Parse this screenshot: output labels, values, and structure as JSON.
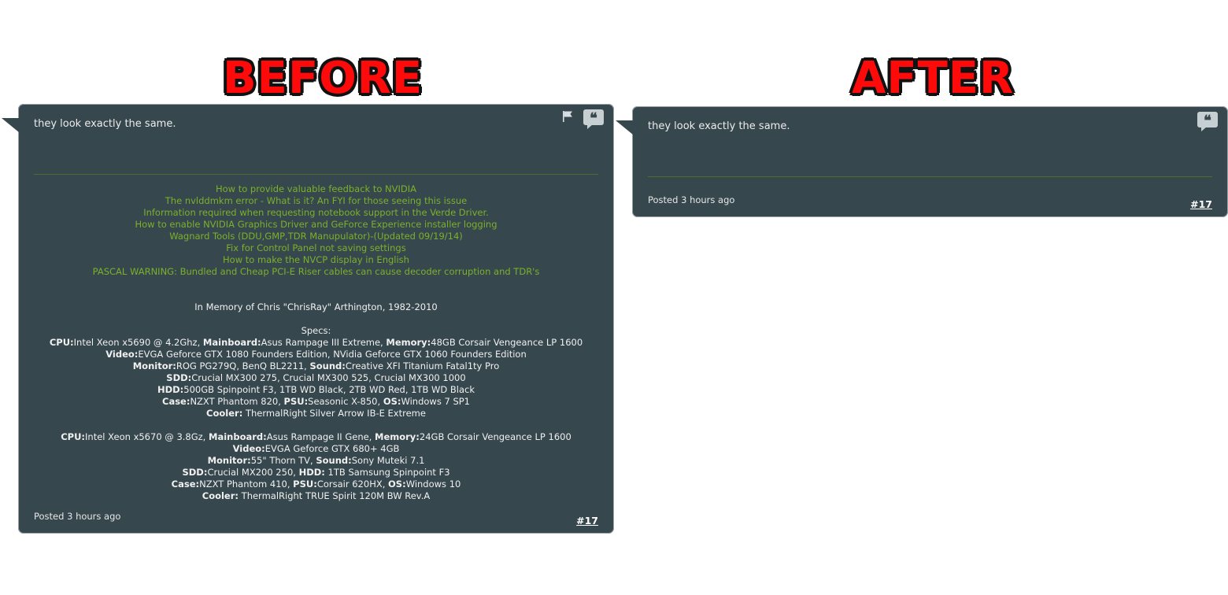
{
  "headings": {
    "before": "BEFORE",
    "after": "AFTER"
  },
  "before_post": {
    "text": "they look exactly the same.",
    "signature_links": [
      "How to provide valuable feedback to NVIDIA",
      "The nvlddmkm error - What is it? An FYI for those seeing this issue",
      "Information required when requesting notebook support in the Verde Driver.",
      "How to enable NVIDIA Graphics Driver and GeForce Experience installer logging",
      "Wagnard Tools (DDU,GMP,TDR Manupulator)-(Updated 09/19/14)",
      "Fix for Control Panel not saving settings",
      "How to make the NVCP display in English",
      "PASCAL WARNING: Bundled and Cheap PCI-E Riser cables can cause decoder corruption and TDR's"
    ],
    "memory": "In Memory of Chris \"ChrisRay\" Arthington, 1982-2010",
    "specs_heading": "Specs:",
    "rig1": {
      "cpu_label": "CPU:",
      "cpu": "Intel Xeon x5690 @ 4.2Ghz, ",
      "mainboard_label": "Mainboard:",
      "mainboard": "Asus Rampage III Extreme, ",
      "memory_label": "Memory:",
      "memory": "48GB Corsair Vengeance LP 1600",
      "video_label": "Video:",
      "video": "EVGA Geforce GTX 1080 Founders Edition, NVidia Geforce GTX 1060 Founders Edition",
      "monitor_label": "Monitor:",
      "monitor": "ROG PG279Q, BenQ BL2211, ",
      "sound_label": "Sound:",
      "sound": "Creative XFI Titanium Fatal1ty Pro",
      "sdd_label": "SDD:",
      "sdd": "Crucial MX300 275, Crucial MX300 525, Crucial MX300 1000",
      "hdd_label": "HDD:",
      "hdd": "500GB Spinpoint F3, 1TB WD Black, 2TB WD Red, 1TB WD Black",
      "case_label": "Case:",
      "case": "NZXT Phantom 820, ",
      "psu_label": "PSU:",
      "psu": "Seasonic X-850, ",
      "os_label": "OS:",
      "os": "Windows 7 SP1",
      "cooler_label": "Cooler:",
      "cooler": " ThermalRight Silver Arrow IB-E Extreme"
    },
    "rig2": {
      "cpu_label": "CPU:",
      "cpu": "Intel Xeon x5670 @ 3.8Gz, ",
      "mainboard_label": "Mainboard:",
      "mainboard": "Asus Rampage II Gene, ",
      "memory_label": "Memory:",
      "memory": "24GB Corsair Vengeance LP 1600",
      "video_label": "Video:",
      "video": "EVGA Geforce GTX 680+ 4GB",
      "monitor_label": "Monitor:",
      "monitor": "55\" Thorn TV, ",
      "sound_label": "Sound:",
      "sound": "Sony Muteki 7.1",
      "sdd_label": "SDD:",
      "sdd": "Crucial MX200 250, ",
      "hdd_label": "HDD:",
      "hdd": " 1TB Samsung Spinpoint F3",
      "case_label": "Case:",
      "case": "NZXT Phantom 410, ",
      "psu_label": "PSU:",
      "psu": "Corsair 620HX, ",
      "os_label": "OS:",
      "os": "Windows 10",
      "cooler_label": "Cooler:",
      "cooler": " ThermalRight TRUE Spirit 120M BW Rev.A"
    },
    "posted": "Posted 3 hours ago",
    "number": "#17",
    "icons": [
      "flag-icon",
      "quote-icon"
    ]
  },
  "after_post": {
    "text": "they look exactly the same.",
    "posted": "Posted 3 hours ago",
    "number": "#17",
    "icons": [
      "quote-icon"
    ]
  },
  "colors": {
    "post_background": "#37474e",
    "link_green": "#7bb12a",
    "heading_red": "#ff0a0a"
  }
}
